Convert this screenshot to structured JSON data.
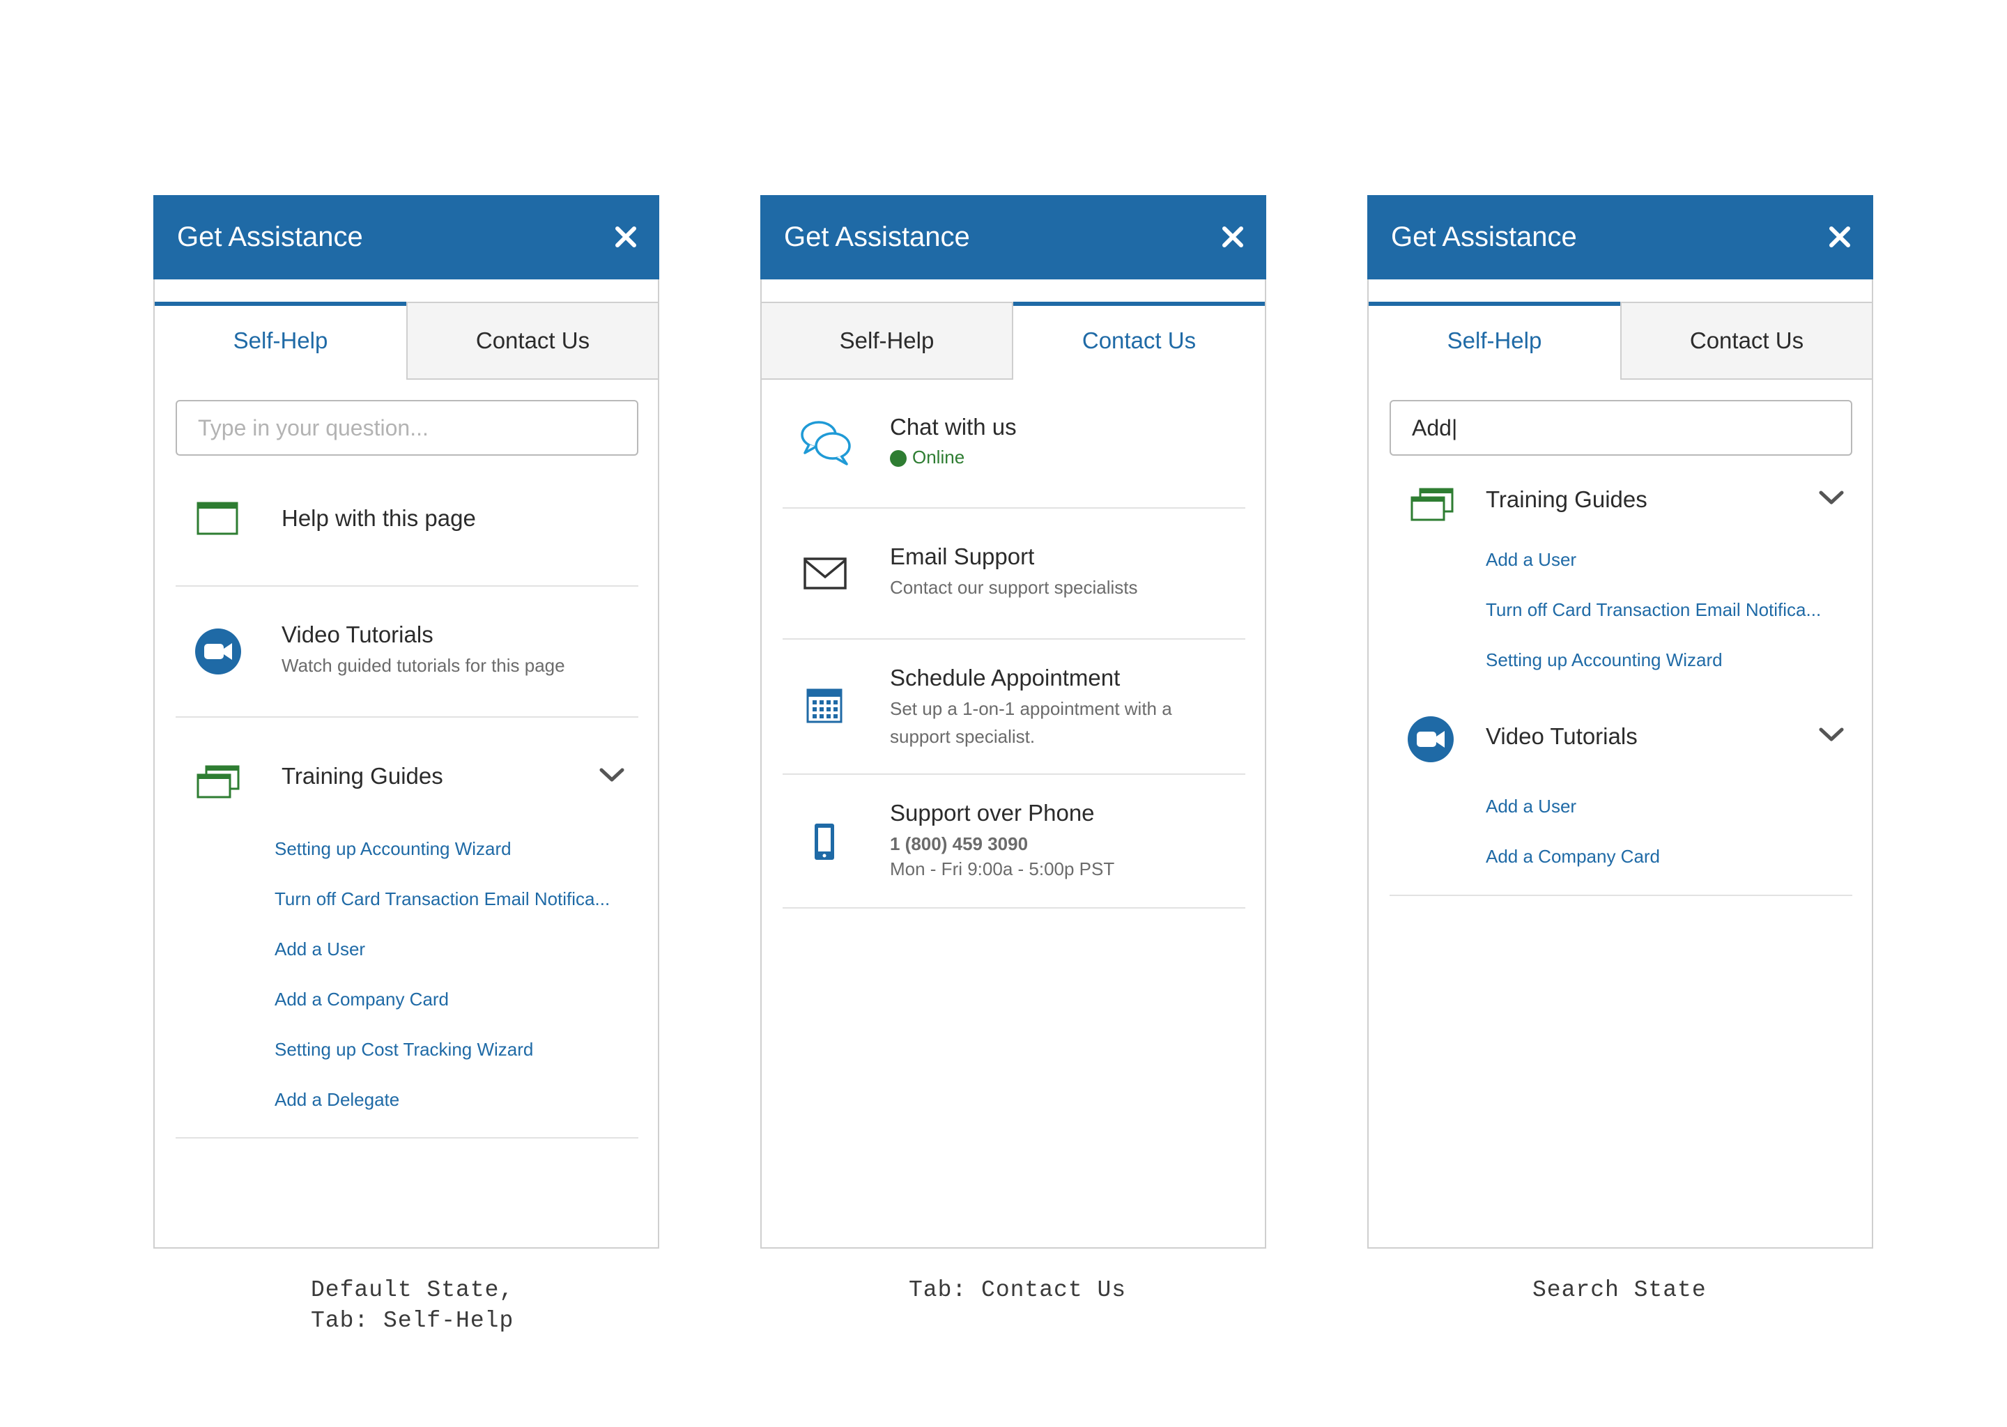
{
  "panel_title": "Get Assistance",
  "tabs": {
    "self_help": "Self-Help",
    "contact_us": "Contact Us"
  },
  "colors": {
    "brand_blue": "#1f6aa6",
    "online_green": "#2e7d32",
    "link_blue": "#1f6aa6"
  },
  "default_state": {
    "search_placeholder": "Type in your question...",
    "help_page": {
      "icon": "browser-window-icon",
      "title": "Help with this page"
    },
    "video": {
      "icon": "video-camera-icon",
      "title": "Video Tutorials",
      "subtitle": "Watch guided tutorials for this page"
    },
    "training": {
      "icon": "stacked-windows-icon",
      "title": "Training Guides",
      "links": [
        "Setting up Accounting Wizard",
        "Turn off Card Transaction Email Notifica...",
        "Add a User",
        "Add a Company Card",
        "Setting up Cost Tracking Wizard",
        "Add a Delegate"
      ]
    },
    "caption": "Default State,\nTab: Self-Help"
  },
  "contact_state": {
    "chat": {
      "icon": "chat-bubbles-icon",
      "title": "Chat with us",
      "status": "Online"
    },
    "email": {
      "icon": "envelope-icon",
      "title": "Email Support",
      "subtitle": "Contact our support specialists"
    },
    "schedule": {
      "icon": "calendar-icon",
      "title": "Schedule Appointment",
      "subtitle_line1": "Set up a 1-on-1 appointment with a",
      "subtitle_line2": "support specialist."
    },
    "phone": {
      "icon": "mobile-phone-icon",
      "title": "Support over Phone",
      "number": "1 (800) 459 3090",
      "hours": "Mon - Fri 9:00a - 5:00p PST"
    },
    "caption": "Tab: Contact Us"
  },
  "search_state": {
    "search_value": "Add|",
    "training": {
      "title": "Training Guides",
      "links": [
        "Add a User",
        "Turn off Card Transaction Email Notifica...",
        "Setting up Accounting Wizard"
      ]
    },
    "video": {
      "title": "Video Tutorials",
      "links": [
        "Add a User",
        "Add a Company Card"
      ]
    },
    "caption": "Search State"
  }
}
